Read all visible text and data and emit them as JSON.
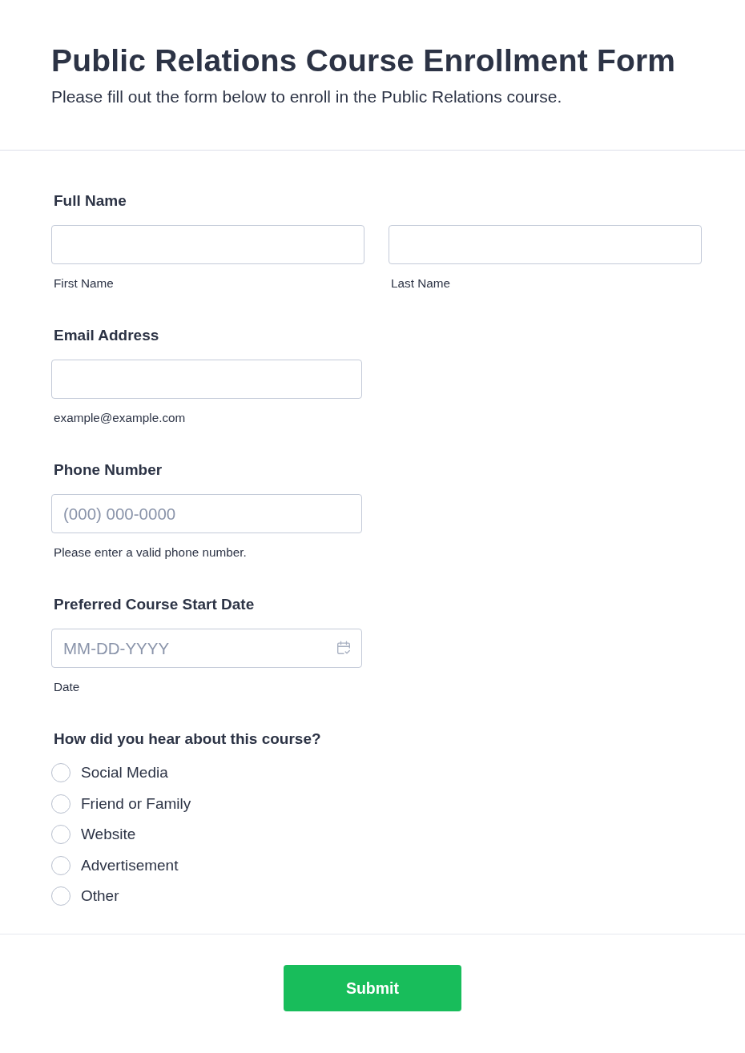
{
  "header": {
    "title": "Public Relations Course Enrollment Form",
    "subtitle": "Please fill out the form below to enroll in the Public Relations course."
  },
  "fields": [
    {
      "kind": "split",
      "label": "Full Name",
      "parts": [
        {
          "sublabel": "First Name"
        },
        {
          "sublabel": "Last Name"
        }
      ]
    },
    {
      "kind": "text",
      "label": "Email Address",
      "sublabel": "example@example.com"
    },
    {
      "kind": "text",
      "label": "Phone Number",
      "placeholder": "(000) 000-0000",
      "sublabel": "Please enter a valid phone number."
    },
    {
      "kind": "date",
      "label": "Preferred Course Start Date",
      "placeholder": "MM-DD-YYYY",
      "sublabel": "Date"
    },
    {
      "kind": "radio",
      "label": "How did you hear about this course?",
      "options": [
        {
          "label": "Social Media",
          "selected": false
        },
        {
          "label": "Friend or Family",
          "selected": false
        },
        {
          "label": "Website",
          "selected": false
        },
        {
          "label": "Advertisement",
          "selected": false
        },
        {
          "label": "Other",
          "selected": false
        }
      ]
    }
  ],
  "submit": {
    "label": "Submit"
  }
}
